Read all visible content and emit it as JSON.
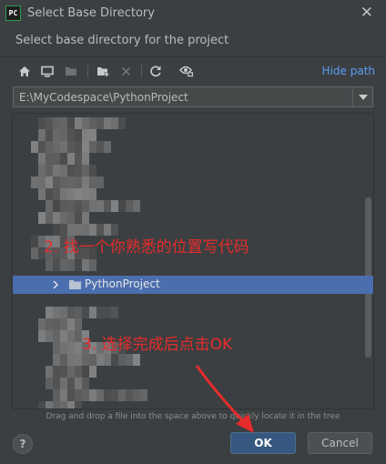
{
  "window": {
    "app_icon_text": "PC",
    "title": "Select Base Directory",
    "close_symbol": "✕"
  },
  "subtitle": "Select base directory for the project",
  "toolbar": {
    "icons": [
      "home-icon",
      "desktop-icon",
      "project-folder-icon",
      "new-folder-icon",
      "delete-icon",
      "refresh-icon",
      "show-hidden-icon"
    ],
    "hide_path_label": "Hide path"
  },
  "path": {
    "value": "E:\\MyCodespace\\PythonProject",
    "dropdown_icon": "chevron-down-icon"
  },
  "tree": {
    "selected_item": {
      "label": "PythonProject",
      "icon": "folder-icon",
      "expand_icon": "chevron-right-icon"
    },
    "colors": {
      "selection": "#4b6eaf",
      "background": "#3c3f41"
    }
  },
  "annotations": {
    "step2": "2. 找一个你熟悉的位置写代码",
    "step3": "3. 选择完成后点击OK",
    "color": "#e52c2c"
  },
  "hint": "Drag and drop a file into the space above to quickly locate it in the tree",
  "buttons": {
    "help": "?",
    "ok": "OK",
    "cancel": "Cancel"
  }
}
